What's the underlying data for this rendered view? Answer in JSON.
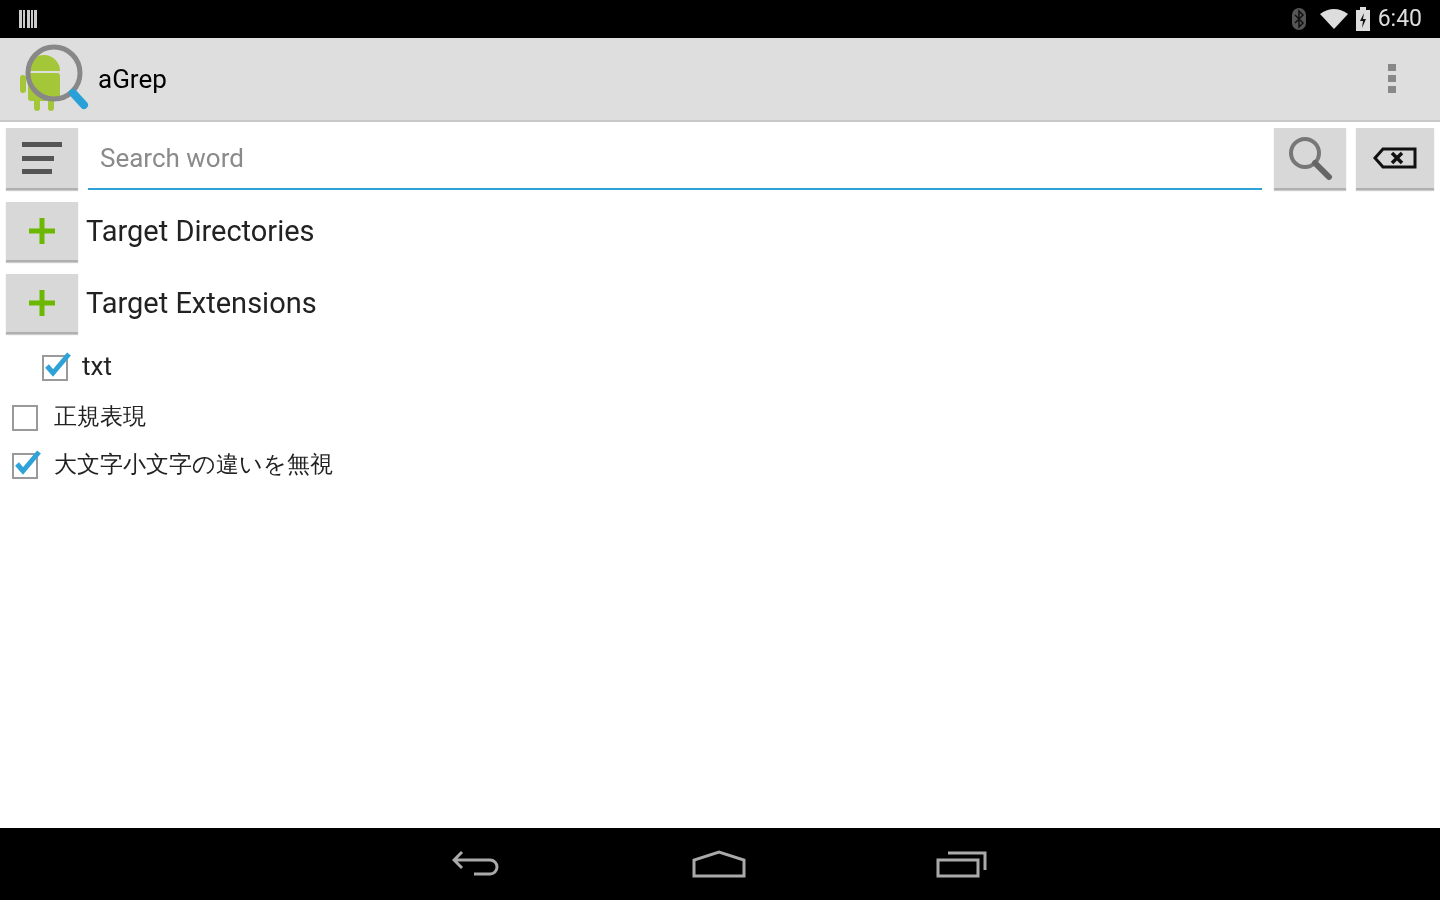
{
  "status_bar": {
    "time": "6:40"
  },
  "action_bar": {
    "title": "aGrep"
  },
  "search": {
    "placeholder": "Search word"
  },
  "sections": [
    {
      "label": "Target Directories"
    },
    {
      "label": "Target Extensions",
      "items": [
        {
          "label": "txt",
          "checked": true
        }
      ]
    }
  ],
  "options": [
    {
      "label": "正規表現",
      "checked": false
    },
    {
      "label": "大文字小文字の違いを無視",
      "checked": true
    }
  ]
}
